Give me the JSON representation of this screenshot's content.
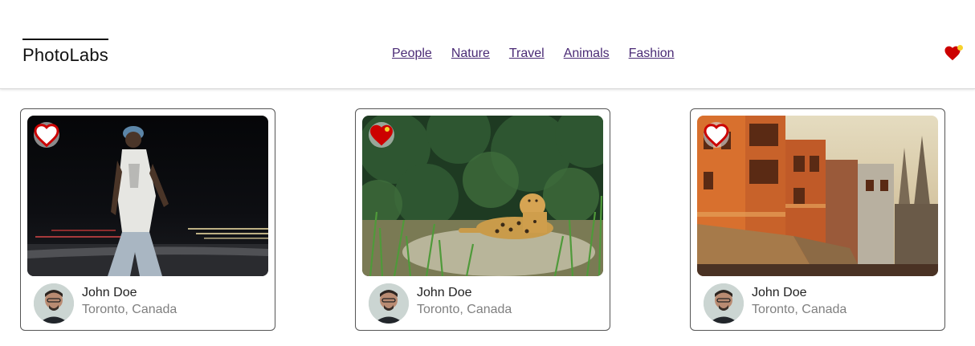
{
  "app": {
    "logo": "PhotoLabs"
  },
  "nav": {
    "topics": [
      "People",
      "Nature",
      "Travel",
      "Animals",
      "Fashion"
    ],
    "favorites_icon": "heart-icon",
    "favorites_notification": true
  },
  "colors": {
    "heart_red": "#cc0000",
    "notification_yellow": "#f7d22d",
    "link_purple": "#4a2a75",
    "location_gray": "#808080"
  },
  "photos": [
    {
      "subject": "man in cap walking at night",
      "favorited": false,
      "user": {
        "name": "John Doe",
        "location": "Toronto, Canada"
      }
    },
    {
      "subject": "jaguar resting in grass",
      "favorited": true,
      "user": {
        "name": "John Doe",
        "location": "Toronto, Canada"
      }
    },
    {
      "subject": "orange riverside buildings",
      "favorited": false,
      "user": {
        "name": "John Doe",
        "location": "Toronto, Canada"
      }
    }
  ]
}
